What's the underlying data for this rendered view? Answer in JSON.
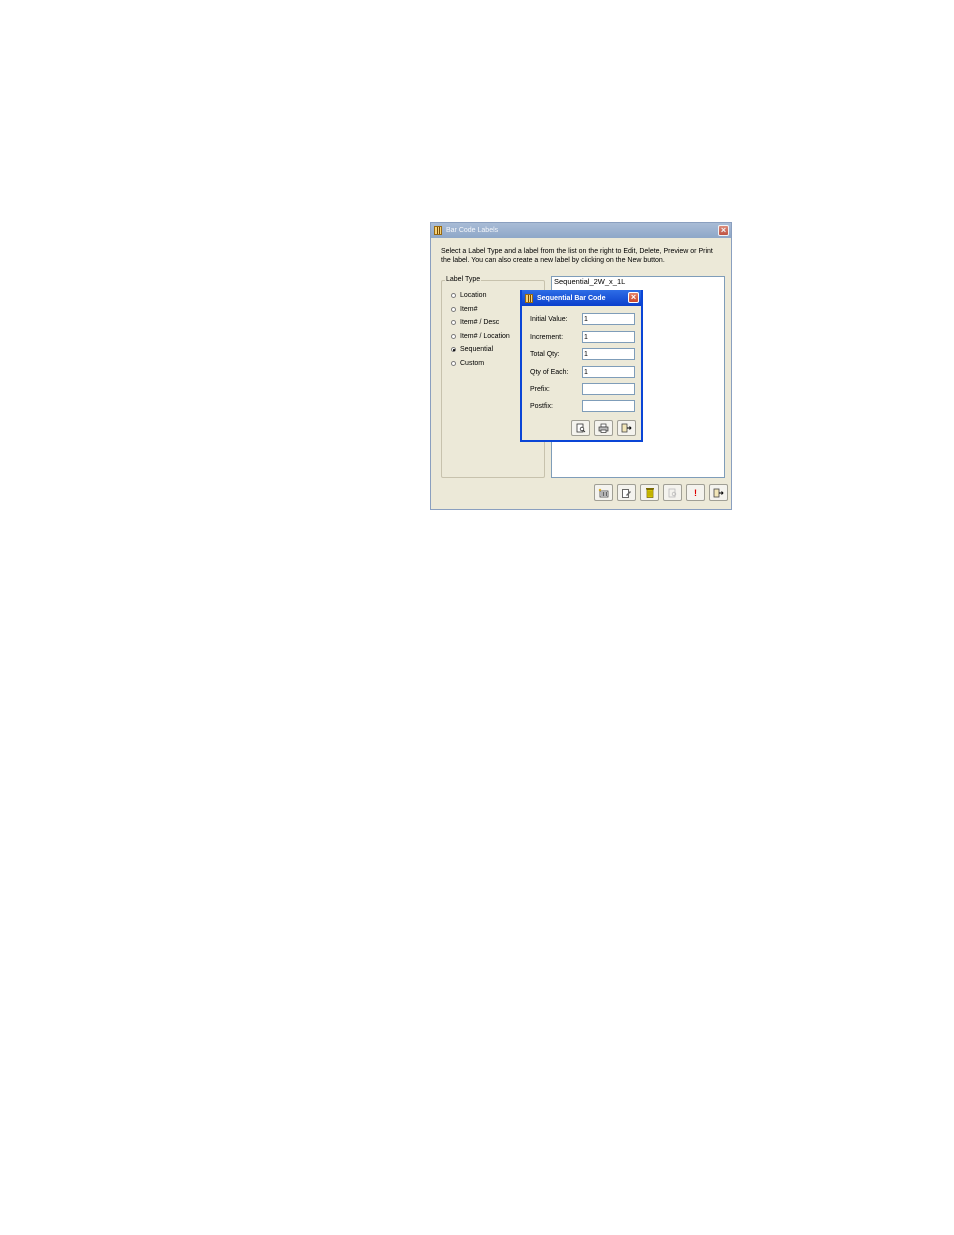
{
  "main_window": {
    "title": "Bar Code Labels",
    "instructions": "Select a Label Type and a label from the list on the right to Edit, Delete, Preview or Print the label. You can also create a new label by clicking on the New button.",
    "label_type_group": {
      "legend": "Label Type",
      "options": [
        {
          "label": "Location",
          "checked": false
        },
        {
          "label": "Item#",
          "checked": false
        },
        {
          "label": "Item# / Desc",
          "checked": false
        },
        {
          "label": "Item# / Location",
          "checked": false
        },
        {
          "label": "Sequential",
          "checked": true
        },
        {
          "label": "Custom",
          "checked": false
        }
      ]
    },
    "label_list": [
      "Sequential_2W_x_1L"
    ],
    "toolbar_icons": [
      "new-label-icon",
      "edit-icon",
      "delete-icon",
      "preview-icon",
      "print-icon",
      "exit-icon"
    ]
  },
  "sequential_dialog": {
    "title": "Sequential Bar Code",
    "fields": [
      {
        "label": "Initial Value:",
        "value": "1"
      },
      {
        "label": "Increment:",
        "value": "1"
      },
      {
        "label": "Total Qty:",
        "value": "1"
      },
      {
        "label": "Qty of Each:",
        "value": "1"
      },
      {
        "label": "Prefix:",
        "value": ""
      },
      {
        "label": "Postfix:",
        "value": ""
      }
    ],
    "button_icons": [
      "preview-icon",
      "print-icon",
      "exit-icon"
    ]
  },
  "colors": {
    "window_bg": "#ece9d8",
    "active_title": "#0a45d6",
    "inactive_title": "#8ea7c8"
  }
}
